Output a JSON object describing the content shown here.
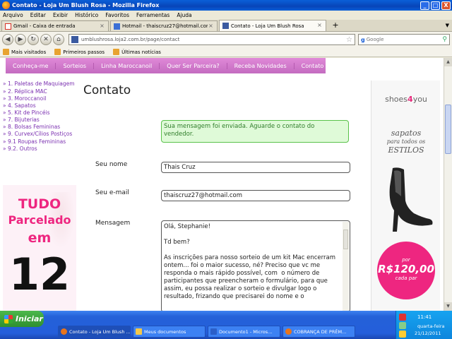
{
  "window": {
    "title": "Contato - Loja Um Blush Rosa - Mozilla Firefox",
    "controls": [
      "_",
      "□",
      "X"
    ]
  },
  "menu": [
    "Arquivo",
    "Editar",
    "Exibir",
    "Histórico",
    "Favoritos",
    "Ferramentas",
    "Ajuda"
  ],
  "tabs": [
    {
      "label": "Gmail - Caixa de entrada",
      "icon": "gmail-icon",
      "color": "#d93025"
    },
    {
      "label": "Hotmail - thaiscruz27@hotmail.com",
      "icon": "hotmail-icon",
      "color": "#3b6fd6"
    },
    {
      "label": "Contato - Loja Um Blush Rosa",
      "icon": "loja2-icon",
      "color": "#3b5aa0"
    }
  ],
  "nav": {
    "url": "umblushrosa.loja2.com.br/page/contact",
    "search_placeholder": "Google"
  },
  "bookmarks": [
    "Mais visitados",
    "Primeiros passos",
    "Últimas notícias"
  ],
  "site_nav": [
    "Conheça-me",
    "Sorteios",
    "Linha Maroccanoil",
    "Quer Ser Parceira?",
    "Receba Novidades",
    "Contato"
  ],
  "categories": [
    "» 1. Paletas de Maquiagem",
    "» 2. Réplica MAC",
    "» 3. Moroccanoil",
    "» 4. Sapatos",
    "» 5. Kit de Pincéis",
    "» 7. Bijuterias",
    "» 8. Bolsas Femininas",
    "» 9. Curvex/Cílios Postiços",
    "» 9.1 Roupas Femininas",
    "» 9.2. Outros"
  ],
  "promo": {
    "line1": "TUDO",
    "line2": "Parcelado",
    "line3": "em",
    "line4": "12"
  },
  "page": {
    "heading": "Contato",
    "success": "Sua mensagem foi enviada. Aguarde o contato do vendedor.",
    "name_label": "Seu nome",
    "name_value": "Thais Cruz",
    "email_label": "Seu e-mail",
    "email_value": "thaiscruz27@hotmail.com",
    "message_label": "Mensagem",
    "message_value": "Olá, Stephanie!\n\nTd bem?\n\nAs inscrições para nosso sorteio de um kit Mac encerram ontem... foi o maior sucesso, né? Preciso que vc me responda o mais rápido possível, com  o número de participantes que preencheram o formulário, para que assim, eu possa realizar o sorteio e divulgar logo o resultado, frizando que precisarei do nome e o"
  },
  "ad": {
    "brand_a": "shoes",
    "brand_b": "4",
    "brand_c": "you",
    "tag1": "sapatos",
    "tag2": "para todos os",
    "tag3": "ESTILOS",
    "badge1": "por",
    "badge2": "R$120,00",
    "badge3": "cada par"
  },
  "taskbar": {
    "start": "Iniciar",
    "tasks": [
      {
        "label": "Contato - Loja Um Blush ...",
        "color": "#e8741c",
        "active": true
      },
      {
        "label": "Meus documentos",
        "color": "#f3c74a",
        "active": false
      },
      {
        "label": "Documento1 - Micros...",
        "color": "#2b5fc9",
        "active": false
      },
      {
        "label": "COBRANÇA DE PRÊM...",
        "color": "#e8741c",
        "active": false
      }
    ],
    "time": "11:41",
    "day": "quarta-feira",
    "date": "21/12/2011"
  }
}
